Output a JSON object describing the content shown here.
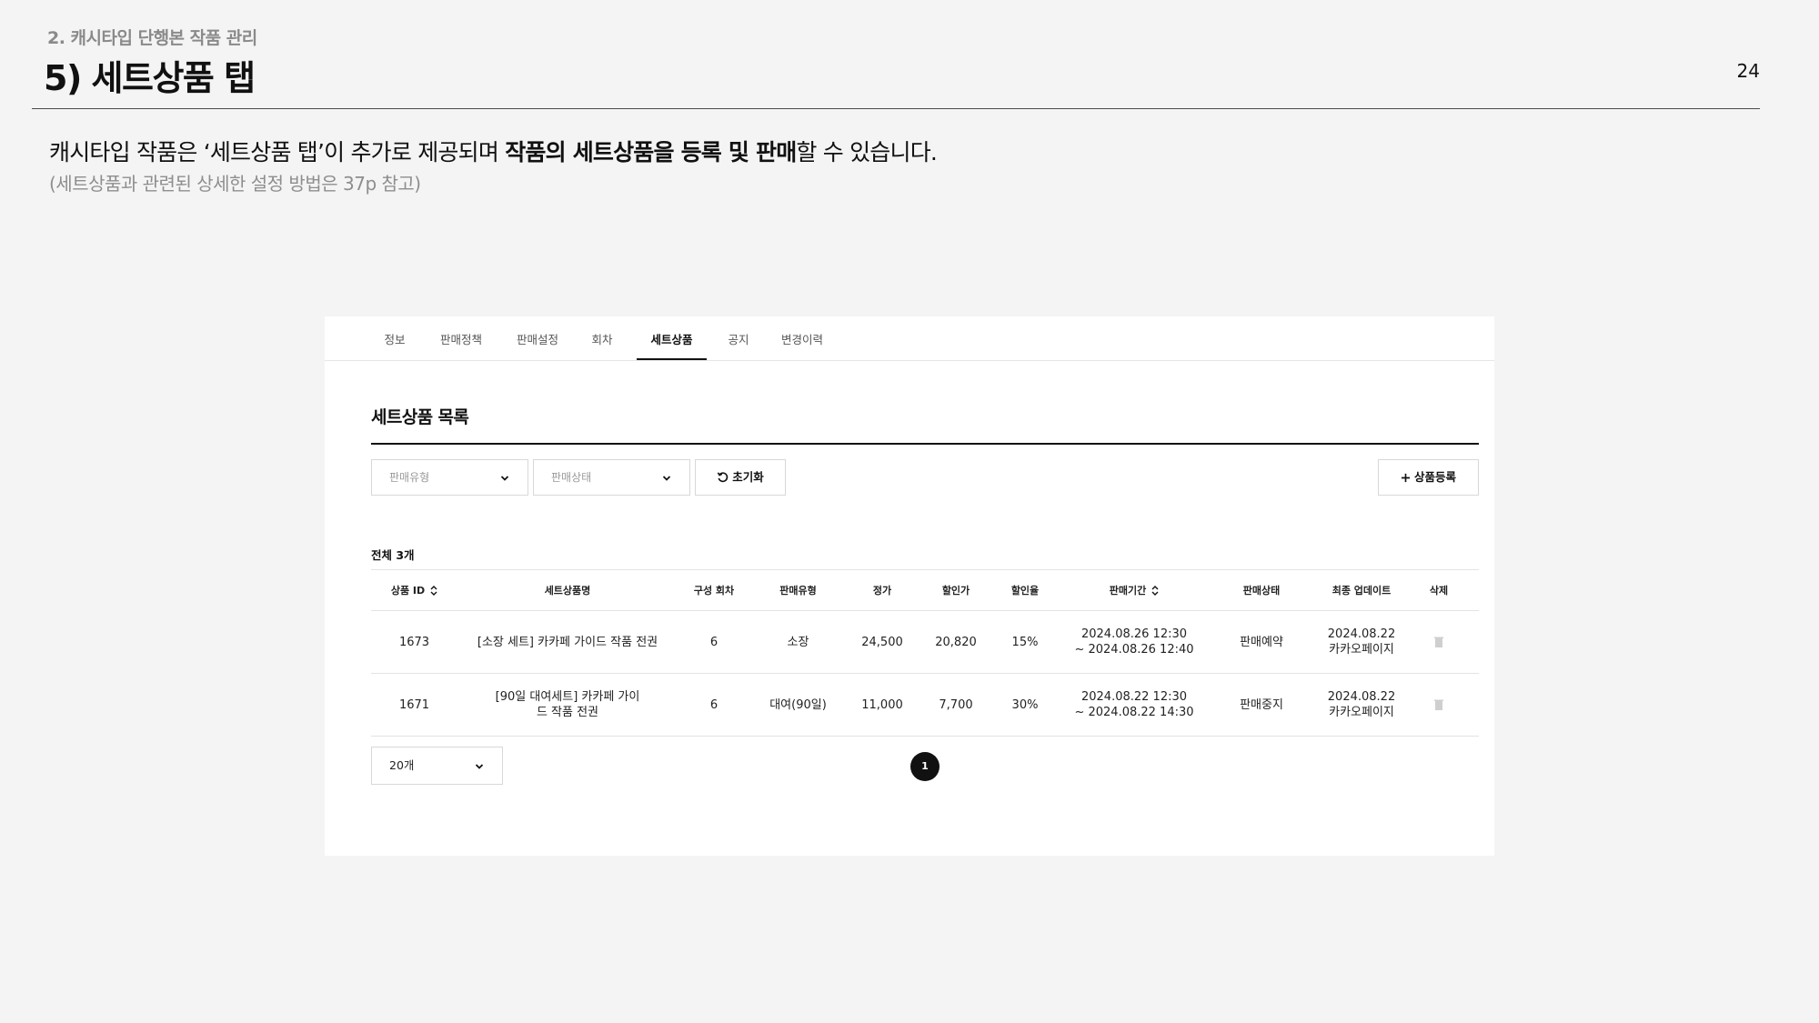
{
  "header": {
    "section": "2. 캐시타입 단행본 작품 관리",
    "title": "5) 세트상품 탭",
    "page_number": "24"
  },
  "intro": {
    "lead_pre": "캐시타입 작품은 ‘세트상품 탭’이 추가로 제공되며 ",
    "lead_bold": "작품의 세트상품을 등록 및 판매",
    "lead_post": "할 수 있습니다.",
    "sub": "(세트상품과 관련된 상세한 설정 방법은 37p 참고)"
  },
  "tabs": [
    {
      "label": "정보"
    },
    {
      "label": "판매정책"
    },
    {
      "label": "판매설정"
    },
    {
      "label": "회차"
    },
    {
      "label": "세트상품"
    },
    {
      "label": "공지"
    },
    {
      "label": "변경이력"
    }
  ],
  "active_tab": "세트상품",
  "list": {
    "title": "세트상품 목록",
    "filters": {
      "sale_type_placeholder": "판매유형",
      "sale_status_placeholder": "판매상태",
      "reset_label": "초기화",
      "add_label": "상품등록"
    },
    "total_label": "전체 3개"
  },
  "table": {
    "columns": [
      "상품 ID",
      "세트상품명",
      "구성 회차",
      "판매유형",
      "정가",
      "할인가",
      "할인율",
      "판매기간",
      "판매상태",
      "최종 업데이트",
      "삭제"
    ],
    "rows": [
      {
        "id": "1673",
        "name": "[소장 세트] 카카페 가이드 작품 전권",
        "episodes": "6",
        "sale_type": "소장",
        "price": "24,500",
        "discount_price": "20,820",
        "discount_rate": "15%",
        "period_start": "2024.08.26 12:30",
        "period_end": "~ 2024.08.26 12:40",
        "status": "판매예약",
        "updated_date": "2024.08.22",
        "updated_by": "카카오페이지"
      },
      {
        "id": "1671",
        "name": "[90일 대여세트] 카카페 가이드 작품 전권",
        "episodes": "6",
        "sale_type": "대여(90일)",
        "price": "11,000",
        "discount_price": "7,700",
        "discount_rate": "30%",
        "period_start": "2024.08.22 12:30",
        "period_end": "~ 2024.08.22 14:30",
        "status": "판매중지",
        "updated_date": "2024.08.22",
        "updated_by": "카카오페이지"
      }
    ]
  },
  "pagination": {
    "page_size": "20개",
    "current_page": "1"
  },
  "colors": {
    "background": "#f4f4f4",
    "panel": "#ffffff",
    "text": "#111111",
    "muted": "#8e8e8e",
    "border": "#d8d8d8"
  }
}
